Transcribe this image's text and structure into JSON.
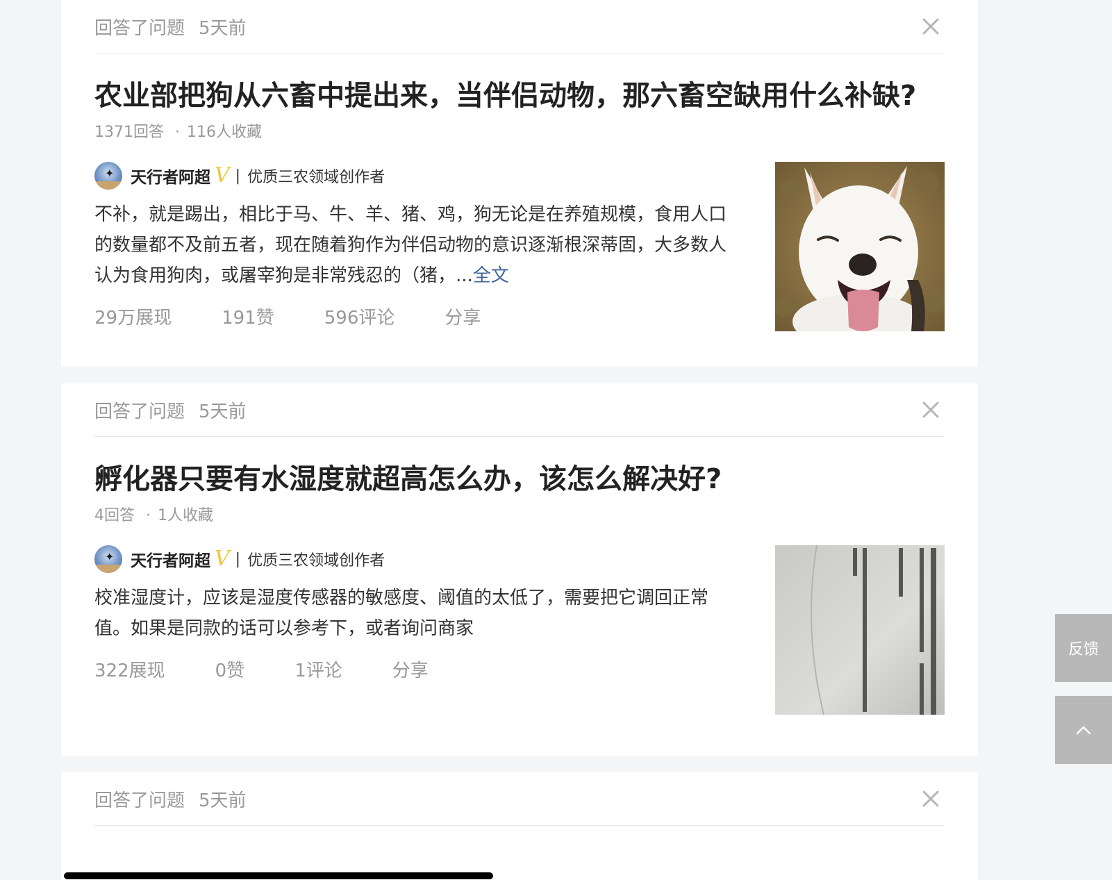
{
  "cards": [
    {
      "header": {
        "action": "回答了问题",
        "time": "5天前"
      },
      "title": "农业部把狗从六畜中提出来，当伴侣动物，那六畜空缺用什么补缺?",
      "meta": {
        "answers": "1371回答",
        "dot": "·",
        "favorites": "116人收藏"
      },
      "author": {
        "name": "天行者阿超",
        "badge": "V",
        "divider": "|",
        "tag": "优质三农领域创作者"
      },
      "answer": "不补，就是踢出，相比于马、牛、羊、猪、鸡，狗无论是在养殖规模，食用人口的数量都不及前五者，现在随着狗作为伴侣动物的意识逐渐根深蒂固，大多数人认为食用狗肉，或屠宰狗是非常残忍的（猪，...",
      "read_more": "全文",
      "stats": {
        "views": "29万展现",
        "likes": "191赞",
        "comments": "596评论",
        "share": "分享"
      },
      "image_icon": "white-dog-photo"
    },
    {
      "header": {
        "action": "回答了问题",
        "time": "5天前"
      },
      "title": "孵化器只要有水湿度就超高怎么办，该怎么解决好?",
      "meta": {
        "answers": "4回答",
        "dot": "·",
        "favorites": "1人收藏"
      },
      "author": {
        "name": "天行者阿超",
        "badge": "V",
        "divider": "|",
        "tag": "优质三农领域创作者"
      },
      "answer": "校准湿度计，应该是湿度传感器的敏感度、阈值的太低了，需要把它调回正常值。如果是同款的话可以参考下，或者询问商家",
      "stats": {
        "views": "322展现",
        "likes": "0赞",
        "comments": "1评论",
        "share": "分享"
      },
      "image_icon": "printed-paper-photo"
    },
    {
      "header": {
        "action": "回答了问题",
        "time": "5天前"
      }
    }
  ],
  "side": {
    "feedback": "反馈",
    "top_icon": "chevron-up-icon"
  },
  "colors": {
    "background": "#f4f5f6",
    "card": "#ffffff",
    "link": "#406599",
    "badge": "#f2c43d",
    "side_button": "#b8b8b8"
  }
}
